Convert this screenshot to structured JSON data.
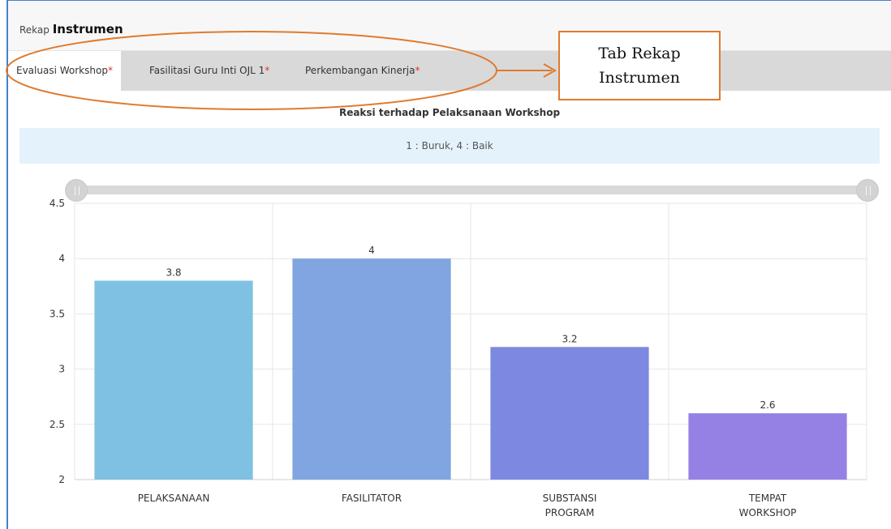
{
  "header": {
    "prefix": "Rekap",
    "title": "Instrumen"
  },
  "tabs": [
    {
      "label": "Evaluasi Workshop",
      "required": "*",
      "active": true
    },
    {
      "label": "Fasilitasi Guru Inti OJL 1",
      "required": "*",
      "active": false
    },
    {
      "label": "Perkembangan Kinerja",
      "required": "*",
      "active": false
    }
  ],
  "annotation": {
    "line1": "Tab Rekap",
    "line2": "Instrumen",
    "color": "#e07a2e"
  },
  "chart_title": "Reaksi terhadap Pelaksanaan Workshop",
  "scale_note": "1 : Buruk, 4 : Baik",
  "chart_data": {
    "type": "bar",
    "categories": [
      [
        "PELAKSANAAN"
      ],
      [
        "FASILITATOR"
      ],
      [
        "SUBSTANSI",
        "PROGRAM"
      ],
      [
        "TEMPAT",
        "WORKSHOP"
      ]
    ],
    "values": [
      3.8,
      4,
      3.2,
      2.6
    ],
    "value_labels": [
      "3.8",
      "4",
      "3.2",
      "2.6"
    ],
    "ylim": [
      2,
      4.5
    ],
    "yticks": [
      2,
      2.5,
      3,
      3.5,
      4,
      4.5
    ],
    "ytick_labels": [
      "2",
      "2.5",
      "3",
      "3.5",
      "4",
      "4.5"
    ],
    "colors": [
      "#7fc1e2",
      "#80a5e0",
      "#7d88e0",
      "#9580e4"
    ],
    "grid": true
  }
}
